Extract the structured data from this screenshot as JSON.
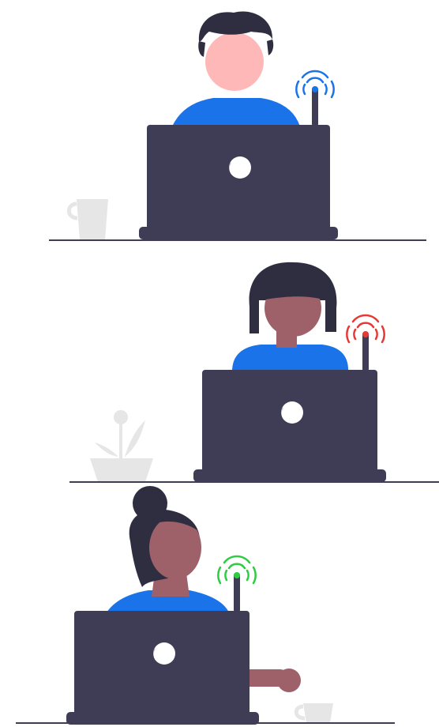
{
  "colors": {
    "laptop": "#3f3d56",
    "shirt": "#1a73e8",
    "hair": "#2f2e41",
    "skin_light": "#ffb8b8",
    "skin_dark": "#9e616a",
    "desk_line": "#3f3d56",
    "decor_gray": "#e6e6e6",
    "signal_good": "#1a73e8",
    "signal_bad": "#e53935",
    "signal_ok": "#2ecc40"
  },
  "scenes": [
    {
      "person": "short-hair-person",
      "signal_status": "blue",
      "prop": "mug"
    },
    {
      "person": "bob-hair-person",
      "signal_status": "red",
      "prop": "plant"
    },
    {
      "person": "bun-hair-person",
      "signal_status": "green",
      "prop": "mug"
    }
  ]
}
